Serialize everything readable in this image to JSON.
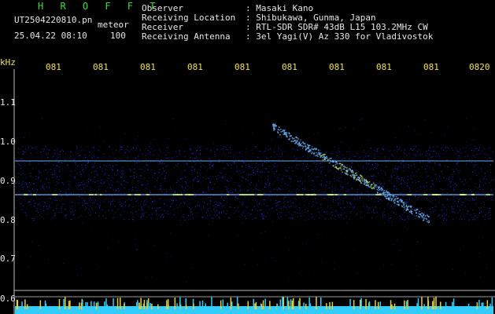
{
  "header": {
    "app_title": "H R O F F T",
    "filename": "UT2504220810.pn",
    "overlay_label": "meteor",
    "timestamp": "25.04.22 08:10",
    "gain_value": "100",
    "info_rows": [
      {
        "label": "Observer",
        "value": ": Masaki Kano"
      },
      {
        "label": "Receiving Location",
        "value": ": Shibukawa, Gunma, Japan"
      },
      {
        "label": "Receiver",
        "value": ": RTL-SDR SDR# 43dB L15 103.2MHz CW"
      },
      {
        "label": "Receiving Antenna",
        "value": ": 3el Yagi(V) Az 330 for Vladivostok"
      }
    ]
  },
  "time_axis": {
    "ticks": [
      "081",
      "081",
      "081",
      "081",
      "081",
      "081",
      "081",
      "081",
      "081",
      "0820"
    ]
  },
  "freq_axis": {
    "unit": "kHz",
    "ticks": [
      {
        "label": "1.1",
        "value": 1.1
      },
      {
        "label": "1.0",
        "value": 1.0
      },
      {
        "label": "0.9",
        "value": 0.9
      },
      {
        "label": "0.8",
        "value": 0.8
      },
      {
        "label": "0.7",
        "value": 0.7
      },
      {
        "label": "0.6",
        "value": 0.6
      }
    ]
  },
  "colors": {
    "background": "#000000",
    "noise": "#2a3cff",
    "signal": "#6fb6ff",
    "signal_hot": "#d8ff66",
    "bottom_bar": "#33ccff",
    "bottom_spikes": "#e0d040",
    "header_green": "#3ddc3d",
    "text_white": "#e6e6e6",
    "text_yellow": "#f0e05a"
  }
}
